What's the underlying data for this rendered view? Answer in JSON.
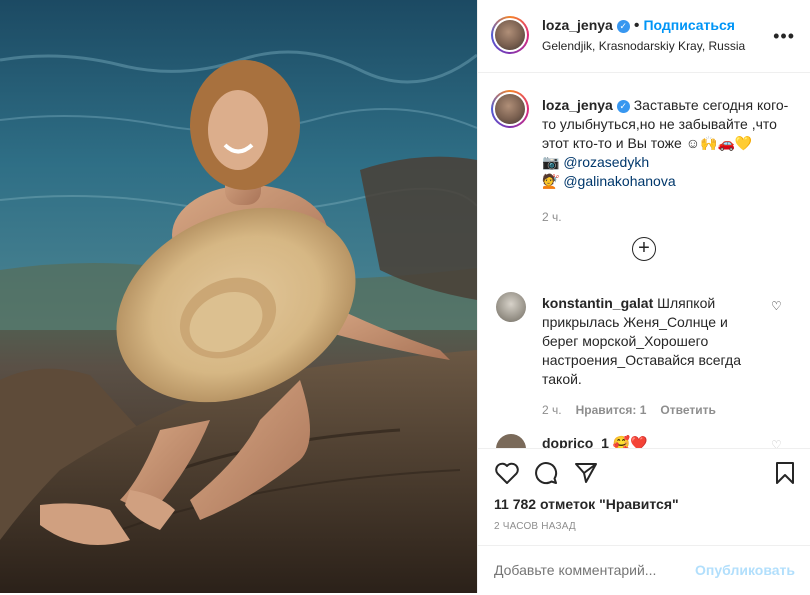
{
  "post": {
    "username": "loza_jenya",
    "follow_label": "Подписаться",
    "location": "Gelendjik, Krasnodarskiy Kray, Russia",
    "more_icon": "more-horizontal-icon"
  },
  "caption": {
    "username": "loza_jenya",
    "text_line1": "Заставьте сегодня кого-",
    "text_line2": "то улыбнуться,но не забывайте ,что",
    "text_line3": "этот кто-то и Вы тоже ☺🙌🚗💛",
    "mention1_emoji": "📷",
    "mention1": "@rozasedykh",
    "mention2_emoji": "💇",
    "mention2": "@galinakohanova",
    "time": "2 ч."
  },
  "comments": [
    {
      "username": "konstantin_galat",
      "line1": "Шляпкой",
      "line2": "прикрылась Женя_Солнце и",
      "line3": "берег морской_Хорошего",
      "line4": "настроения_Оставайся всегда",
      "line5": "такой.",
      "time": "2 ч.",
      "likes": "Нравится: 1",
      "reply": "Ответить"
    },
    {
      "username": "doprico_1",
      "emoji": "🥰❤️"
    }
  ],
  "actions": {
    "likes_text": "11 782 отметок \"Нравится\"",
    "ago": "2 ЧАСОВ НАЗАД",
    "comment_placeholder": "Добавьте комментарий...",
    "post_label": "Опубликовать"
  },
  "colors": {
    "accent": "#0095f6",
    "link": "#00376b",
    "muted": "#8e8e8e",
    "verified": "#3897f0"
  }
}
